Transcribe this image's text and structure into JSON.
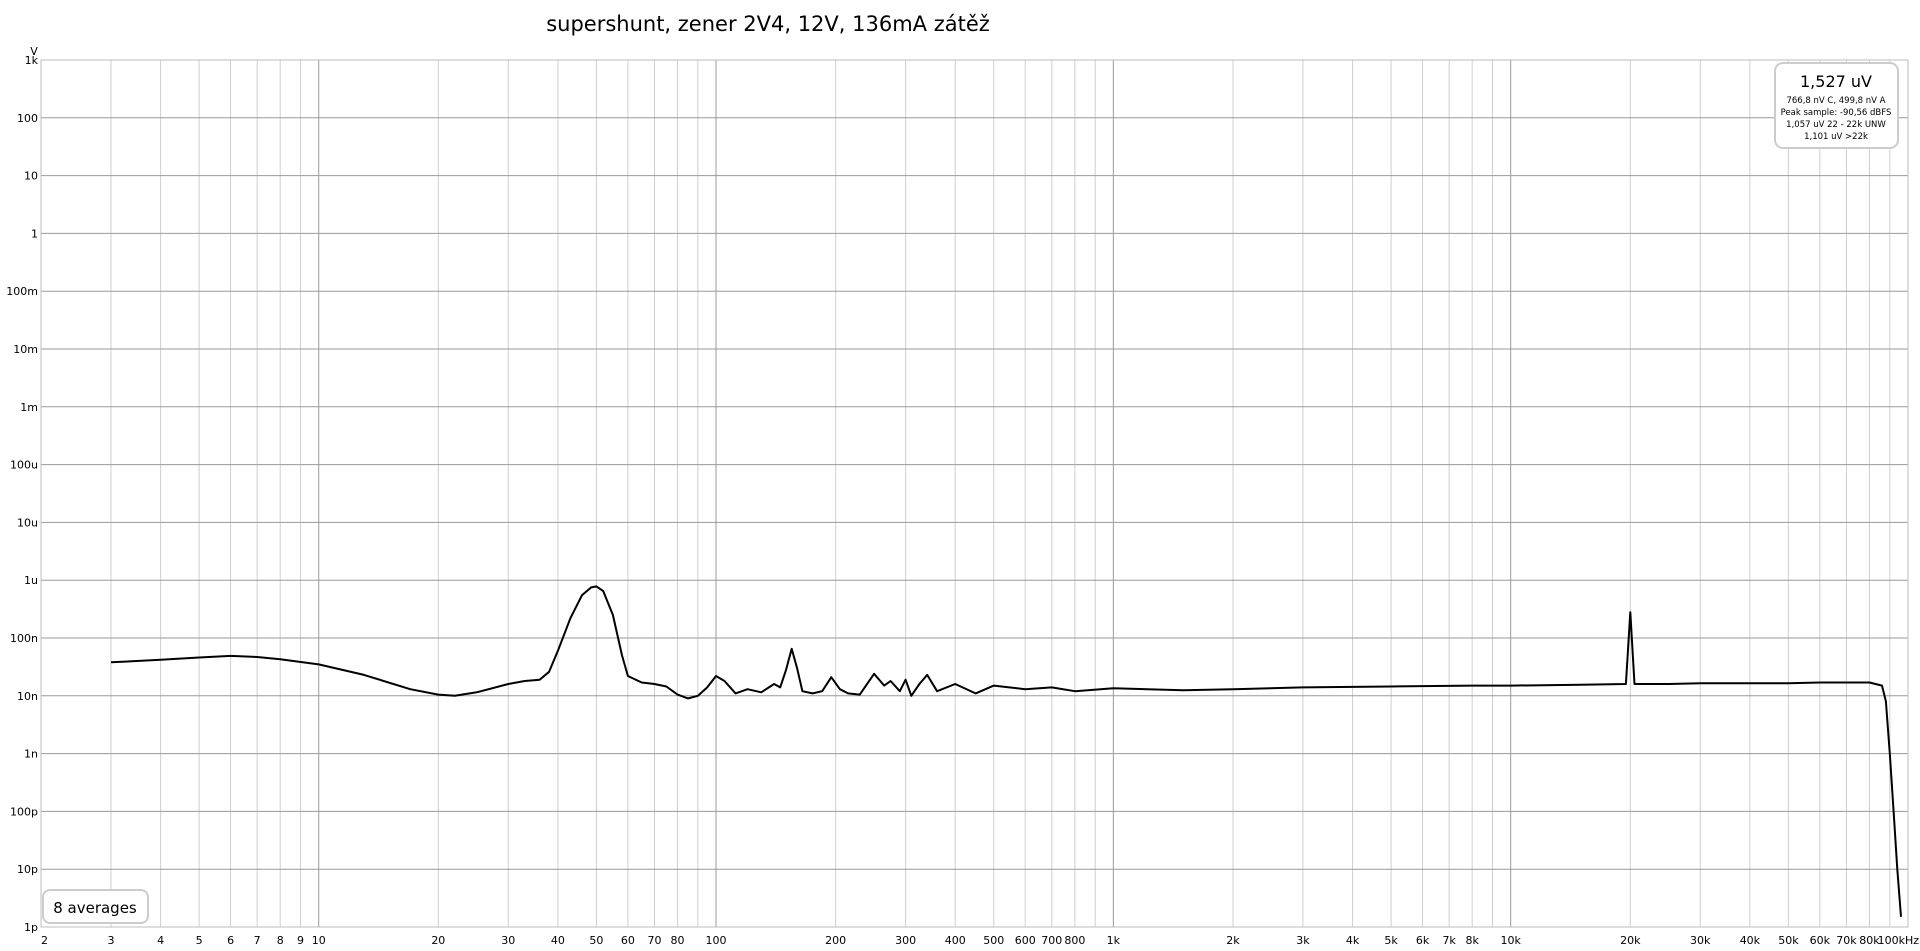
{
  "chart_data": {
    "type": "line",
    "title": "supershunt, zener 2V4, 12V, 136mA zátěž",
    "ylabel": "V",
    "x_scale": "log",
    "y_scale": "log",
    "xlim": [
      2,
      100000
    ],
    "ylim": [
      1e-12,
      1000
    ],
    "grid": true,
    "y_ticks": [
      {
        "value": 1000,
        "label": "1k"
      },
      {
        "value": 100,
        "label": "100"
      },
      {
        "value": 10,
        "label": "10"
      },
      {
        "value": 1,
        "label": "1"
      },
      {
        "value": 0.1,
        "label": "100m"
      },
      {
        "value": 0.01,
        "label": "10m"
      },
      {
        "value": 0.001,
        "label": "1m"
      },
      {
        "value": 0.0001,
        "label": "100u"
      },
      {
        "value": 1e-05,
        "label": "10u"
      },
      {
        "value": 1e-06,
        "label": "1u"
      },
      {
        "value": 1e-07,
        "label": "100n"
      },
      {
        "value": 1e-08,
        "label": "10n"
      },
      {
        "value": 1e-09,
        "label": "1n"
      },
      {
        "value": 1e-10,
        "label": "100p"
      },
      {
        "value": 1e-11,
        "label": "10p"
      },
      {
        "value": 1e-12,
        "label": "1p"
      }
    ],
    "x_ticks": [
      {
        "value": 2,
        "label": "2"
      },
      {
        "value": 3,
        "label": "3"
      },
      {
        "value": 4,
        "label": "4"
      },
      {
        "value": 5,
        "label": "5"
      },
      {
        "value": 6,
        "label": "6"
      },
      {
        "value": 7,
        "label": "7"
      },
      {
        "value": 8,
        "label": "8"
      },
      {
        "value": 9,
        "label": "9"
      },
      {
        "value": 10,
        "label": "10"
      },
      {
        "value": 20,
        "label": "20"
      },
      {
        "value": 30,
        "label": "30"
      },
      {
        "value": 40,
        "label": "40"
      },
      {
        "value": 50,
        "label": "50"
      },
      {
        "value": 60,
        "label": "60"
      },
      {
        "value": 70,
        "label": "70"
      },
      {
        "value": 80,
        "label": "80"
      },
      {
        "value": 100,
        "label": "100"
      },
      {
        "value": 200,
        "label": "200"
      },
      {
        "value": 300,
        "label": "300"
      },
      {
        "value": 400,
        "label": "400"
      },
      {
        "value": 500,
        "label": "500"
      },
      {
        "value": 600,
        "label": "600"
      },
      {
        "value": 700,
        "label": "700"
      },
      {
        "value": 800,
        "label": "800"
      },
      {
        "value": 1000,
        "label": "1k"
      },
      {
        "value": 2000,
        "label": "2k"
      },
      {
        "value": 3000,
        "label": "3k"
      },
      {
        "value": 4000,
        "label": "4k"
      },
      {
        "value": 5000,
        "label": "5k"
      },
      {
        "value": 6000,
        "label": "6k"
      },
      {
        "value": 7000,
        "label": "7k"
      },
      {
        "value": 8000,
        "label": "8k"
      },
      {
        "value": 10000,
        "label": "10k"
      },
      {
        "value": 20000,
        "label": "20k"
      },
      {
        "value": 30000,
        "label": "30k"
      },
      {
        "value": 40000,
        "label": "40k"
      },
      {
        "value": 50000,
        "label": "50k"
      },
      {
        "value": 60000,
        "label": "60k"
      },
      {
        "value": 70000,
        "label": "70k"
      },
      {
        "value": 80000,
        "label": "80k"
      },
      {
        "value": 100000,
        "label": "100kHz"
      }
    ],
    "series": [
      {
        "points": [
          [
            3,
            3.8e-08
          ],
          [
            4,
            4.2e-08
          ],
          [
            5,
            4.6e-08
          ],
          [
            6,
            4.9e-08
          ],
          [
            7,
            4.7e-08
          ],
          [
            8,
            4.3e-08
          ],
          [
            10,
            3.5e-08
          ],
          [
            13,
            2.3e-08
          ],
          [
            17,
            1.3e-08
          ],
          [
            20,
            1.05e-08
          ],
          [
            22,
            1e-08
          ],
          [
            25,
            1.15e-08
          ],
          [
            30,
            1.6e-08
          ],
          [
            33,
            1.8e-08
          ],
          [
            36,
            1.9e-08
          ],
          [
            38,
            2.6e-08
          ],
          [
            40,
            6e-08
          ],
          [
            43,
            2.2e-07
          ],
          [
            46,
            5.5e-07
          ],
          [
            48.5,
            7.5e-07
          ],
          [
            50,
            7.8e-07
          ],
          [
            52,
            6.5e-07
          ],
          [
            55,
            2.5e-07
          ],
          [
            58,
            5e-08
          ],
          [
            60,
            2.2e-08
          ],
          [
            65,
            1.7e-08
          ],
          [
            70,
            1.6e-08
          ],
          [
            75,
            1.45e-08
          ],
          [
            80,
            1.05e-08
          ],
          [
            85,
            9e-09
          ],
          [
            90,
            1e-08
          ],
          [
            95,
            1.4e-08
          ],
          [
            100,
            2.2e-08
          ],
          [
            105,
            1.8e-08
          ],
          [
            112,
            1.1e-08
          ],
          [
            120,
            1.3e-08
          ],
          [
            130,
            1.15e-08
          ],
          [
            140,
            1.6e-08
          ],
          [
            145,
            1.4e-08
          ],
          [
            150,
            2.8e-08
          ],
          [
            155,
            6.5e-08
          ],
          [
            160,
            3e-08
          ],
          [
            165,
            1.2e-08
          ],
          [
            175,
            1.1e-08
          ],
          [
            185,
            1.2e-08
          ],
          [
            195,
            2.1e-08
          ],
          [
            205,
            1.3e-08
          ],
          [
            215,
            1.1e-08
          ],
          [
            230,
            1.05e-08
          ],
          [
            250,
            2.4e-08
          ],
          [
            265,
            1.5e-08
          ],
          [
            275,
            1.8e-08
          ],
          [
            290,
            1.2e-08
          ],
          [
            300,
            1.9e-08
          ],
          [
            310,
            1e-08
          ],
          [
            325,
            1.6e-08
          ],
          [
            340,
            2.3e-08
          ],
          [
            360,
            1.2e-08
          ],
          [
            400,
            1.6e-08
          ],
          [
            450,
            1.1e-08
          ],
          [
            500,
            1.5e-08
          ],
          [
            600,
            1.3e-08
          ],
          [
            700,
            1.4e-08
          ],
          [
            800,
            1.2e-08
          ],
          [
            1000,
            1.35e-08
          ],
          [
            1500,
            1.25e-08
          ],
          [
            2000,
            1.3e-08
          ],
          [
            3000,
            1.4e-08
          ],
          [
            5000,
            1.45e-08
          ],
          [
            8000,
            1.5e-08
          ],
          [
            10000,
            1.5e-08
          ],
          [
            15000,
            1.55e-08
          ],
          [
            19500,
            1.6e-08
          ],
          [
            20000,
            2.8e-07
          ],
          [
            20500,
            1.6e-08
          ],
          [
            25000,
            1.6e-08
          ],
          [
            30000,
            1.65e-08
          ],
          [
            40000,
            1.65e-08
          ],
          [
            50000,
            1.65e-08
          ],
          [
            60000,
            1.7e-08
          ],
          [
            70000,
            1.7e-08
          ],
          [
            80000,
            1.7e-08
          ],
          [
            86000,
            1.5e-08
          ],
          [
            88000,
            8e-09
          ],
          [
            90000,
            1e-09
          ],
          [
            92000,
            1e-10
          ],
          [
            94000,
            1e-11
          ],
          [
            96000,
            1.5e-12
          ]
        ]
      }
    ]
  },
  "rms_readout": {
    "main": "1,527 uV",
    "line1": "766,8 nV C, 499,8 nV A",
    "line2": "Peak sample: -90,56 dBFS",
    "line3": "1,057 uV 22 - 22k UNW",
    "line4": "1,101 uV >22k"
  },
  "averages_label": "8 averages"
}
